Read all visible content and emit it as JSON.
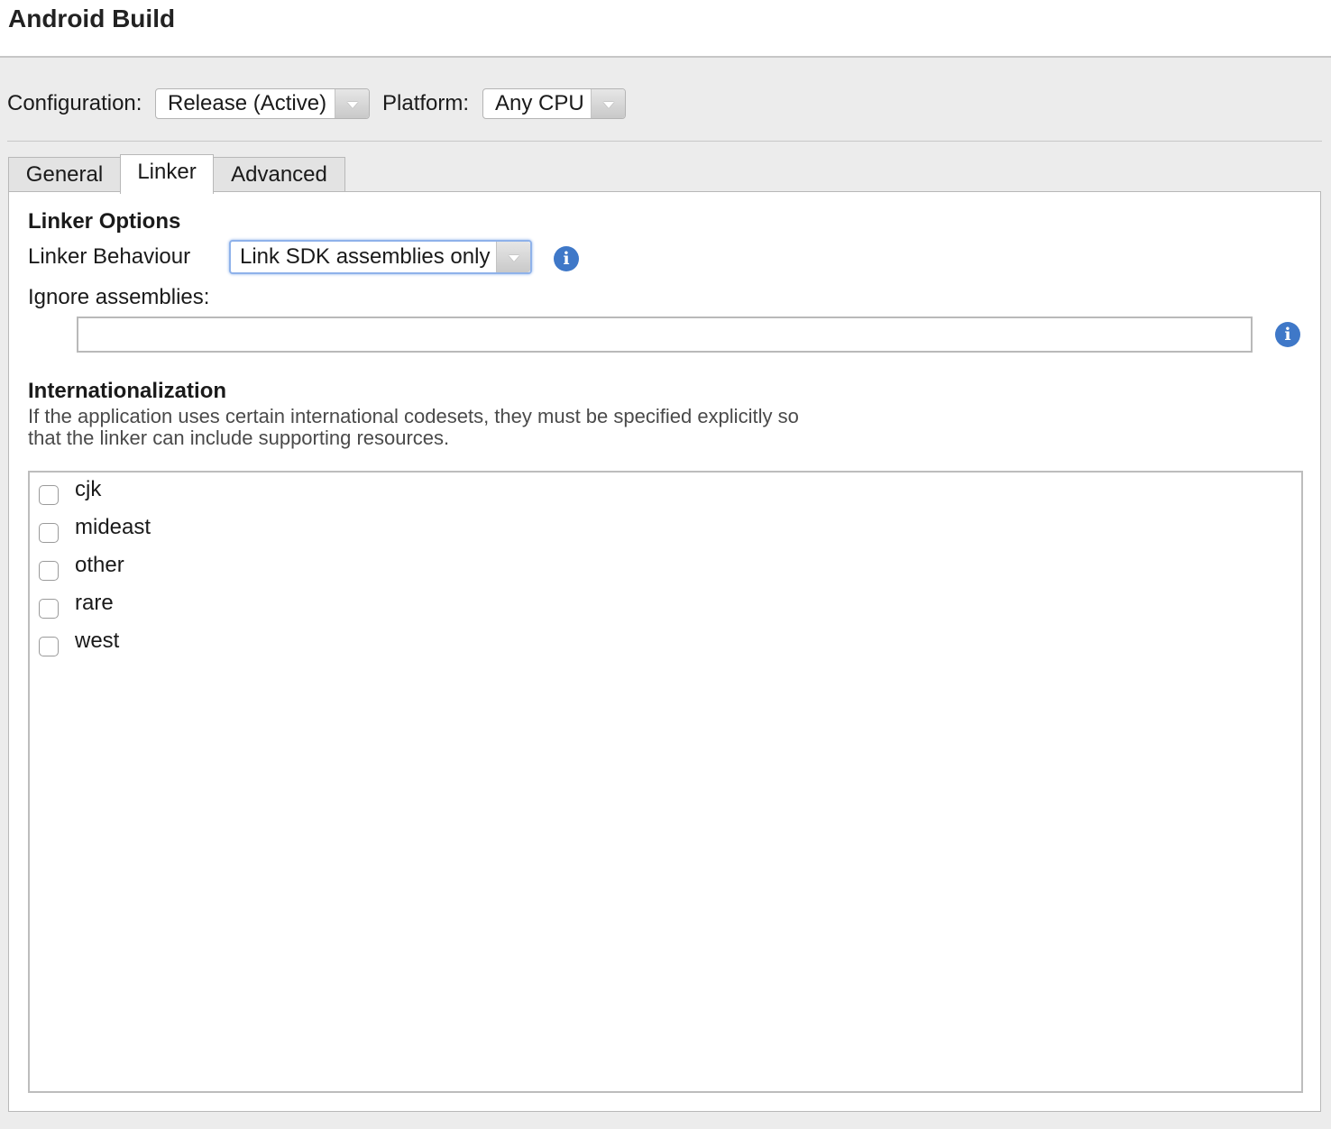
{
  "header": {
    "title": "Android Build"
  },
  "config": {
    "configuration_label": "Configuration:",
    "configuration_value": "Release (Active)",
    "platform_label": "Platform:",
    "platform_value": "Any CPU"
  },
  "tabs": [
    {
      "label": "General",
      "active": false
    },
    {
      "label": "Linker",
      "active": true
    },
    {
      "label": "Advanced",
      "active": false
    }
  ],
  "linker": {
    "section_title": "Linker Options",
    "behaviour_label": "Linker Behaviour",
    "behaviour_value": "Link SDK assemblies only",
    "ignore_label": "Ignore assemblies:",
    "ignore_value": "",
    "info_icon": "info-icon",
    "info_color": "#3f78c8"
  },
  "i18n": {
    "section_title": "Internationalization",
    "description_line1": "If the application uses certain international codesets, they must be specified explicitly so",
    "description_line2": "that the linker can include supporting resources.",
    "codesets": [
      {
        "label": "cjk",
        "checked": false
      },
      {
        "label": "mideast",
        "checked": false
      },
      {
        "label": "other",
        "checked": false
      },
      {
        "label": "rare",
        "checked": false
      },
      {
        "label": "west",
        "checked": false
      }
    ]
  }
}
